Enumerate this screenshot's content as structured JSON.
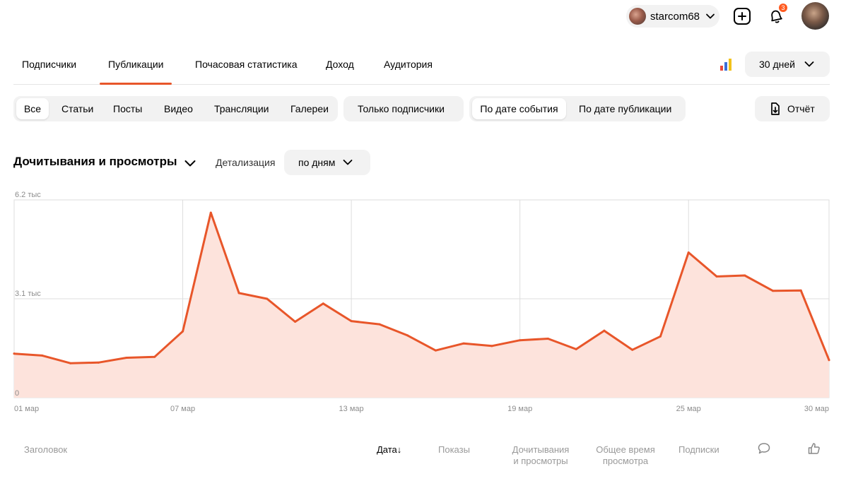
{
  "user": {
    "name": "starcom68",
    "notifications_count": "3"
  },
  "main_tabs": [
    {
      "label": "Подписчики",
      "active": false
    },
    {
      "label": "Публикации",
      "active": true
    },
    {
      "label": "Почасовая статистика",
      "active": false
    },
    {
      "label": "Доход",
      "active": false
    },
    {
      "label": "Аудитория",
      "active": false
    }
  ],
  "period": {
    "label": "30 дней"
  },
  "content_filters": [
    {
      "label": "Все",
      "selected": true
    },
    {
      "label": "Статьи",
      "selected": false
    },
    {
      "label": "Посты",
      "selected": false
    },
    {
      "label": "Видео",
      "selected": false
    },
    {
      "label": "Трансляции",
      "selected": false
    },
    {
      "label": "Галереи",
      "selected": false
    }
  ],
  "subscribers_filter": {
    "label": "Только подписчики"
  },
  "date_mode": [
    {
      "label": "По дате события",
      "selected": true
    },
    {
      "label": "По дате публикации",
      "selected": false
    }
  ],
  "report": {
    "label": "Отчёт"
  },
  "chart_header": {
    "metric": "Дочитывания и просмотры",
    "detail_label": "Детализация",
    "detail_value": "по дням"
  },
  "colors": {
    "accent": "#e8562a",
    "area_fill": "#fde3dc",
    "grid": "#dddddd"
  },
  "chart_data": {
    "type": "area",
    "x": [
      "01 мар",
      "02 мар",
      "03 мар",
      "04 мар",
      "05 мар",
      "06 мар",
      "07 мар",
      "08 мар",
      "09 мар",
      "10 мар",
      "11 мар",
      "12 мар",
      "13 мар",
      "14 мар",
      "15 мар",
      "16 мар",
      "17 мар",
      "18 мар",
      "19 мар",
      "20 мар",
      "21 мар",
      "22 мар",
      "23 мар",
      "24 мар",
      "25 мар",
      "26 мар",
      "27 мар",
      "28 мар",
      "29 мар",
      "30 мар"
    ],
    "series": [
      {
        "values": [
          1380,
          1320,
          1080,
          1100,
          1250,
          1280,
          2080,
          5800,
          3280,
          3100,
          2380,
          2950,
          2400,
          2300,
          1950,
          1480,
          1700,
          1620,
          1800,
          1850,
          1520,
          2100,
          1500,
          1920,
          4550,
          3800,
          3830,
          3350,
          3360,
          1180
        ]
      }
    ],
    "y_ticks": [
      "0",
      "3.1 тыс",
      "6.2 тыс"
    ],
    "y_tick_values": [
      0,
      3100,
      6200
    ],
    "x_tick_labels": [
      "01 мар",
      "07 мар",
      "13 мар",
      "19 мар",
      "25 мар",
      "30 мар"
    ],
    "x_tick_indices": [
      0,
      6,
      12,
      18,
      24,
      29
    ],
    "ylim": [
      0,
      6200
    ],
    "grid": true,
    "legend": "none"
  },
  "table_header": {
    "title": "Заголовок",
    "date": "Дата",
    "sort_arrow": "↓",
    "impressions": "Показы",
    "reads_line1": "Дочитывания",
    "reads_line2": "и просмотры",
    "time_line1": "Общее время",
    "time_line2": "просмотра",
    "subscriptions": "Подписки"
  }
}
